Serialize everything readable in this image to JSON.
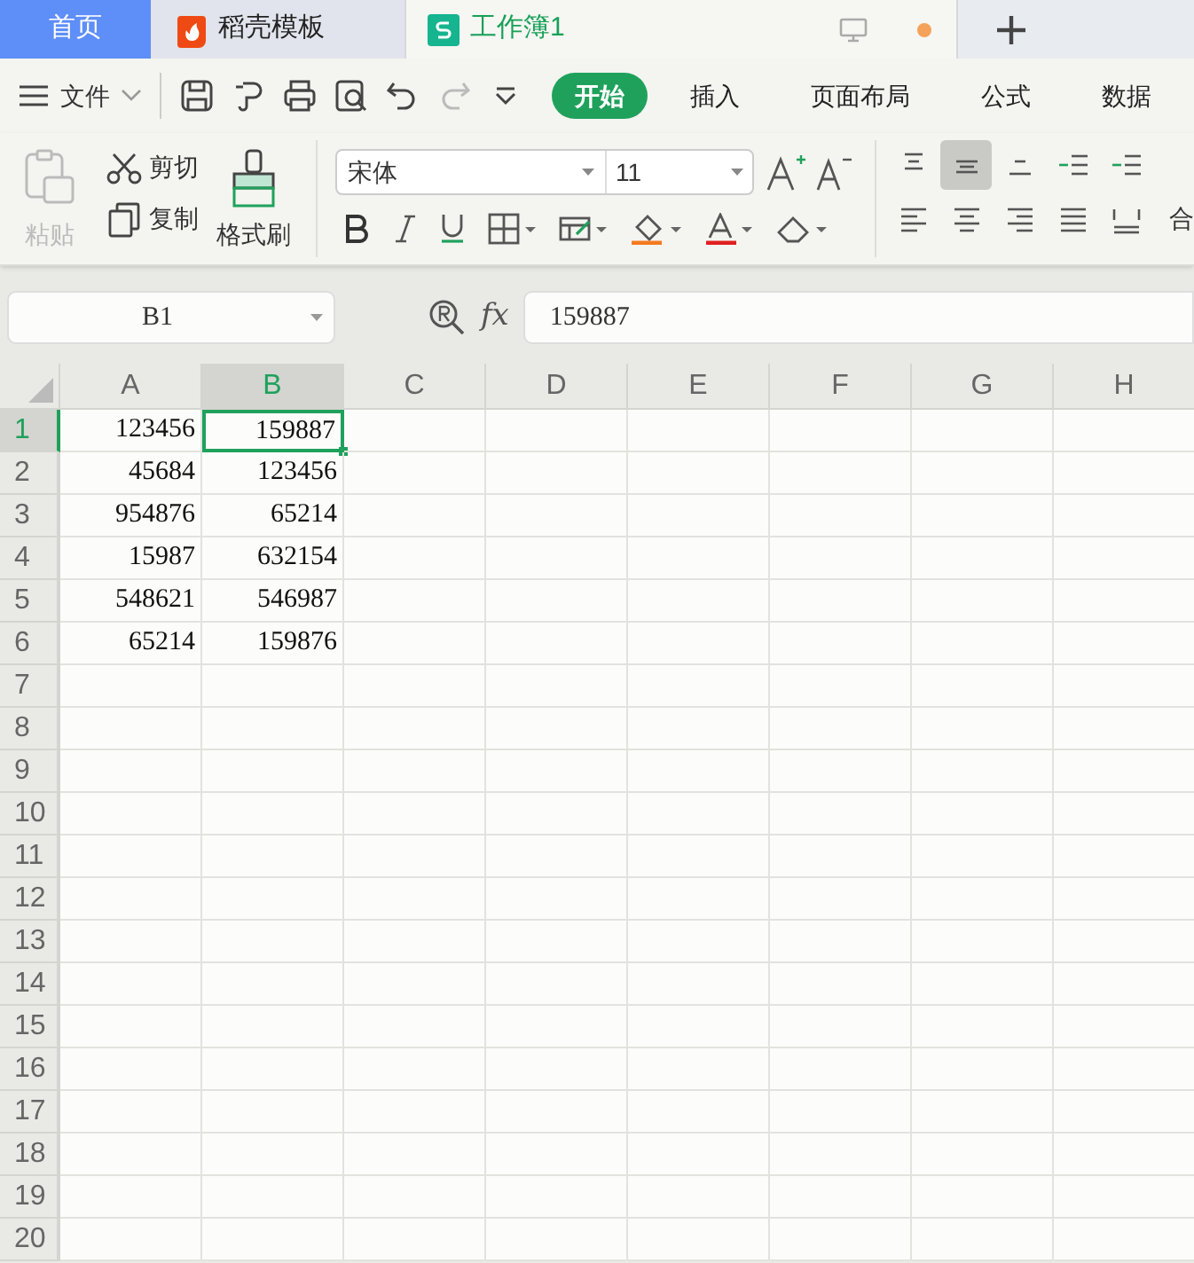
{
  "tabs": [
    {
      "label": "首页",
      "kind": "home",
      "selected": false
    },
    {
      "label": "稻壳模板",
      "kind": "docer",
      "selected": false
    },
    {
      "label": "工作簿1",
      "kind": "sheet",
      "selected": true
    }
  ],
  "file_menu": {
    "label": "文件"
  },
  "ribbon_tabs": [
    {
      "label": "开始",
      "selected": true
    },
    {
      "label": "插入",
      "selected": false
    },
    {
      "label": "页面布局",
      "selected": false
    },
    {
      "label": "公式",
      "selected": false
    },
    {
      "label": "数据",
      "selected": false
    }
  ],
  "clipboard": {
    "paste": {
      "label": "粘贴",
      "disabled": true
    },
    "cut": {
      "label": "剪切"
    },
    "copy": {
      "label": "复制"
    },
    "format_painter": {
      "label": "格式刷"
    }
  },
  "font": {
    "name": "宋体",
    "size": "11"
  },
  "align_buttons": [
    {
      "kind": "top",
      "selected": false
    },
    {
      "kind": "middle",
      "selected": true
    },
    {
      "kind": "bottom",
      "selected": false
    },
    {
      "kind": "outdent",
      "selected": false
    },
    {
      "kind": "indent",
      "selected": false
    },
    {
      "kind": "left",
      "selected": false
    },
    {
      "kind": "center",
      "selected": false
    },
    {
      "kind": "right",
      "selected": false
    },
    {
      "kind": "justify",
      "selected": false
    },
    {
      "kind": "distributed",
      "selected": false
    }
  ],
  "merge": {
    "label": "合"
  },
  "name_box": {
    "value": "B1"
  },
  "formula_bar": {
    "fx": "fx",
    "value": "159887"
  },
  "grid": {
    "columns": [
      {
        "label": "A",
        "selected": false
      },
      {
        "label": "B",
        "selected": true
      },
      {
        "label": "C",
        "selected": false
      },
      {
        "label": "D",
        "selected": false
      },
      {
        "label": "E",
        "selected": false
      },
      {
        "label": "F",
        "selected": false
      },
      {
        "label": "G",
        "selected": false
      },
      {
        "label": "H",
        "selected": false
      }
    ],
    "rows": [
      {
        "label": "1",
        "selected": true,
        "cells": [
          "123456",
          "159887"
        ]
      },
      {
        "label": "2",
        "selected": false,
        "cells": [
          "45684",
          "123456"
        ]
      },
      {
        "label": "3",
        "selected": false,
        "cells": [
          "954876",
          "65214"
        ]
      },
      {
        "label": "4",
        "selected": false,
        "cells": [
          "15987",
          "632154"
        ]
      },
      {
        "label": "5",
        "selected": false,
        "cells": [
          "548621",
          "546987"
        ]
      },
      {
        "label": "6",
        "selected": false,
        "cells": [
          "65214",
          "159876"
        ]
      },
      {
        "label": "7",
        "selected": false,
        "cells": []
      },
      {
        "label": "8",
        "selected": false,
        "cells": []
      },
      {
        "label": "9",
        "selected": false,
        "cells": []
      },
      {
        "label": "10",
        "selected": false,
        "cells": []
      },
      {
        "label": "11",
        "selected": false,
        "cells": []
      },
      {
        "label": "12",
        "selected": false,
        "cells": []
      },
      {
        "label": "13",
        "selected": false,
        "cells": []
      },
      {
        "label": "14",
        "selected": false,
        "cells": []
      },
      {
        "label": "15",
        "selected": false,
        "cells": []
      },
      {
        "label": "16",
        "selected": false,
        "cells": []
      },
      {
        "label": "17",
        "selected": false,
        "cells": []
      },
      {
        "label": "18",
        "selected": false,
        "cells": []
      },
      {
        "label": "19",
        "selected": false,
        "cells": []
      },
      {
        "label": "20",
        "selected": false,
        "cells": []
      }
    ]
  }
}
